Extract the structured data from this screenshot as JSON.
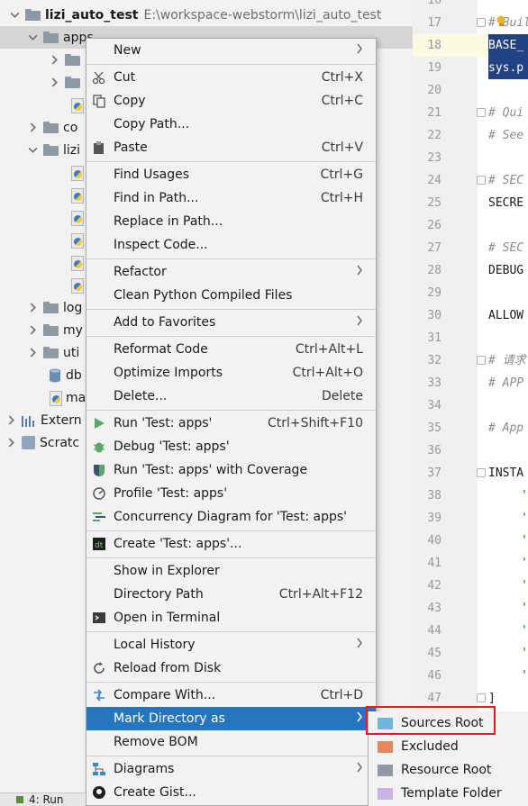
{
  "tree": {
    "rows": [
      {
        "name": "lizi_auto_test",
        "path": "E:\\workspace-webstorm\\lizi_auto_test",
        "bold": true
      },
      {
        "name": "apps"
      },
      {
        "name": ""
      },
      {
        "name": ""
      },
      {
        "name": ""
      },
      {
        "name": "co"
      },
      {
        "name": "lizi"
      },
      {
        "name": ""
      },
      {
        "name": ""
      },
      {
        "name": ""
      },
      {
        "name": ""
      },
      {
        "name": ""
      },
      {
        "name": "log"
      },
      {
        "name": "my"
      },
      {
        "name": "uti"
      },
      {
        "name": "db"
      },
      {
        "name": "ma"
      },
      {
        "name": "Extern"
      },
      {
        "name": "Scratc"
      }
    ]
  },
  "editor": {
    "lines": [
      {
        "num": "16",
        "text": ""
      },
      {
        "num": "17",
        "text": "# Buil"
      },
      {
        "num": "18",
        "text": "BASE_"
      },
      {
        "num": "19",
        "text": "sys.p"
      },
      {
        "num": "20",
        "text": ""
      },
      {
        "num": "21",
        "text": "# Qui"
      },
      {
        "num": "22",
        "text": "# See"
      },
      {
        "num": "23",
        "text": ""
      },
      {
        "num": "24",
        "text": "# SEC"
      },
      {
        "num": "25",
        "text": "SECRE"
      },
      {
        "num": "26",
        "text": ""
      },
      {
        "num": "27",
        "text": "# SEC"
      },
      {
        "num": "28",
        "text": "DEBUG"
      },
      {
        "num": "29",
        "text": ""
      },
      {
        "num": "30",
        "text": "ALLOW"
      },
      {
        "num": "31",
        "text": ""
      },
      {
        "num": "32",
        "text": "# 请求"
      },
      {
        "num": "33",
        "text": "# APP"
      },
      {
        "num": "34",
        "text": ""
      },
      {
        "num": "35",
        "text": "# App"
      },
      {
        "num": "36",
        "text": ""
      },
      {
        "num": "37",
        "text": "INSTA"
      },
      {
        "num": "38",
        "text": "'"
      },
      {
        "num": "39",
        "text": "'"
      },
      {
        "num": "40",
        "text": "'"
      },
      {
        "num": "41",
        "text": "'"
      },
      {
        "num": "42",
        "text": "'"
      },
      {
        "num": "43",
        "text": "'"
      },
      {
        "num": "44",
        "text": "'"
      },
      {
        "num": "45",
        "text": "'"
      },
      {
        "num": "46",
        "text": "'"
      },
      {
        "num": "47",
        "text": "]"
      }
    ]
  },
  "menu": {
    "items": [
      {
        "label": "New",
        "submenu": true
      },
      {
        "sep": true
      },
      {
        "label": "Cut",
        "shortcut": "Ctrl+X",
        "icon": "cut-icon"
      },
      {
        "label": "Copy",
        "shortcut": "Ctrl+C",
        "icon": "copy-icon"
      },
      {
        "label": "Copy Path...",
        "icon": ""
      },
      {
        "label": "Paste",
        "shortcut": "Ctrl+V",
        "icon": "paste-icon"
      },
      {
        "sep": true
      },
      {
        "label": "Find Usages",
        "shortcut": "Ctrl+G"
      },
      {
        "label": "Find in Path...",
        "shortcut": "Ctrl+H"
      },
      {
        "label": "Replace in Path..."
      },
      {
        "label": "Inspect Code..."
      },
      {
        "sep": true
      },
      {
        "label": "Refactor",
        "submenu": true
      },
      {
        "label": "Clean Python Compiled Files"
      },
      {
        "sep": true
      },
      {
        "label": "Add to Favorites",
        "submenu": true
      },
      {
        "sep": true
      },
      {
        "label": "Reformat Code",
        "shortcut": "Ctrl+Alt+L"
      },
      {
        "label": "Optimize Imports",
        "shortcut": "Ctrl+Alt+O"
      },
      {
        "label": "Delete...",
        "shortcut": "Delete"
      },
      {
        "sep": true
      },
      {
        "label": "Run 'Test: apps'",
        "shortcut": "Ctrl+Shift+F10",
        "icon": "run-icon"
      },
      {
        "label": "Debug 'Test: apps'",
        "icon": "debug-icon"
      },
      {
        "label": "Run 'Test: apps' with Coverage",
        "icon": "coverage-icon"
      },
      {
        "label": "Profile 'Test: apps'",
        "icon": "profile-icon"
      },
      {
        "label": "Concurrency Diagram for 'Test: apps'",
        "icon": "concurrency-icon"
      },
      {
        "sep": true
      },
      {
        "label": "Create 'Test: apps'...",
        "icon": "create-test-icon"
      },
      {
        "sep": true
      },
      {
        "label": "Show in Explorer"
      },
      {
        "label": "Directory Path",
        "shortcut": "Ctrl+Alt+F12"
      },
      {
        "label": "Open in Terminal",
        "icon": "terminal-icon"
      },
      {
        "sep": true
      },
      {
        "label": "Local History",
        "submenu": true
      },
      {
        "label": "Reload from Disk",
        "icon": "reload-icon"
      },
      {
        "sep": true
      },
      {
        "label": "Compare With...",
        "shortcut": "Ctrl+D",
        "icon": "compare-icon"
      },
      {
        "label": "Mark Directory as",
        "submenu": true,
        "highlighted": true
      },
      {
        "label": "Remove BOM"
      },
      {
        "sep": true
      },
      {
        "label": "Diagrams",
        "submenu": true,
        "icon": "diagrams-icon"
      },
      {
        "label": "Create Gist...",
        "icon": "github-icon"
      }
    ]
  },
  "submenu": {
    "items": [
      {
        "label": "Sources Root",
        "color": "#6fb6dc"
      },
      {
        "label": "Excluded",
        "color": "#e6875f"
      },
      {
        "label": "Resource Root",
        "color": "#8e99a4"
      },
      {
        "label": "Template Folder",
        "color": "#c9b3e8"
      }
    ]
  },
  "bottom": {
    "run_tab": "4: Run"
  }
}
